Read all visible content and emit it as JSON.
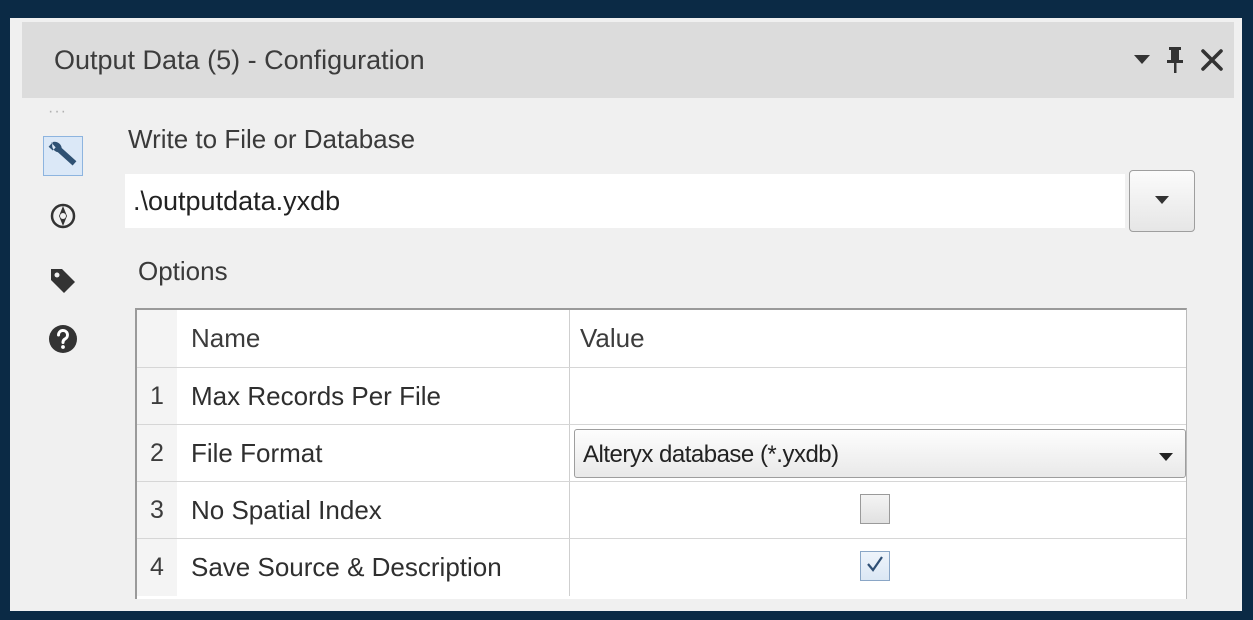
{
  "window": {
    "title": "Output Data (5) - Configuration",
    "controls": {
      "menu": "dropdown-arrow-icon",
      "pin": "pin-icon",
      "close": "close-icon"
    }
  },
  "sidebar": {
    "items": [
      {
        "icon": "wrench-icon",
        "active": true
      },
      {
        "icon": "compass-icon",
        "active": false
      },
      {
        "icon": "tag-icon",
        "active": false
      },
      {
        "icon": "help-icon",
        "active": false
      }
    ]
  },
  "main": {
    "write_label": "Write to File or Database",
    "path_value": ".\\outputdata.yxdb",
    "options_label": "Options",
    "grid": {
      "headers": {
        "name": "Name",
        "value": "Value"
      },
      "rows": [
        {
          "num": "1",
          "name": "Max Records Per File",
          "value": ""
        },
        {
          "num": "2",
          "name": "File Format",
          "value": "Alteryx database (*.yxdb)"
        },
        {
          "num": "3",
          "name": "No Spatial Index",
          "checked": false
        },
        {
          "num": "4",
          "name": "Save Source & Description",
          "checked": true
        }
      ]
    }
  },
  "colors": {
    "frame": "#0b2a45",
    "titlebar": "#dcdcdc",
    "panel": "#f0f0f0",
    "active_icon_bg": "#dbe8f7"
  }
}
